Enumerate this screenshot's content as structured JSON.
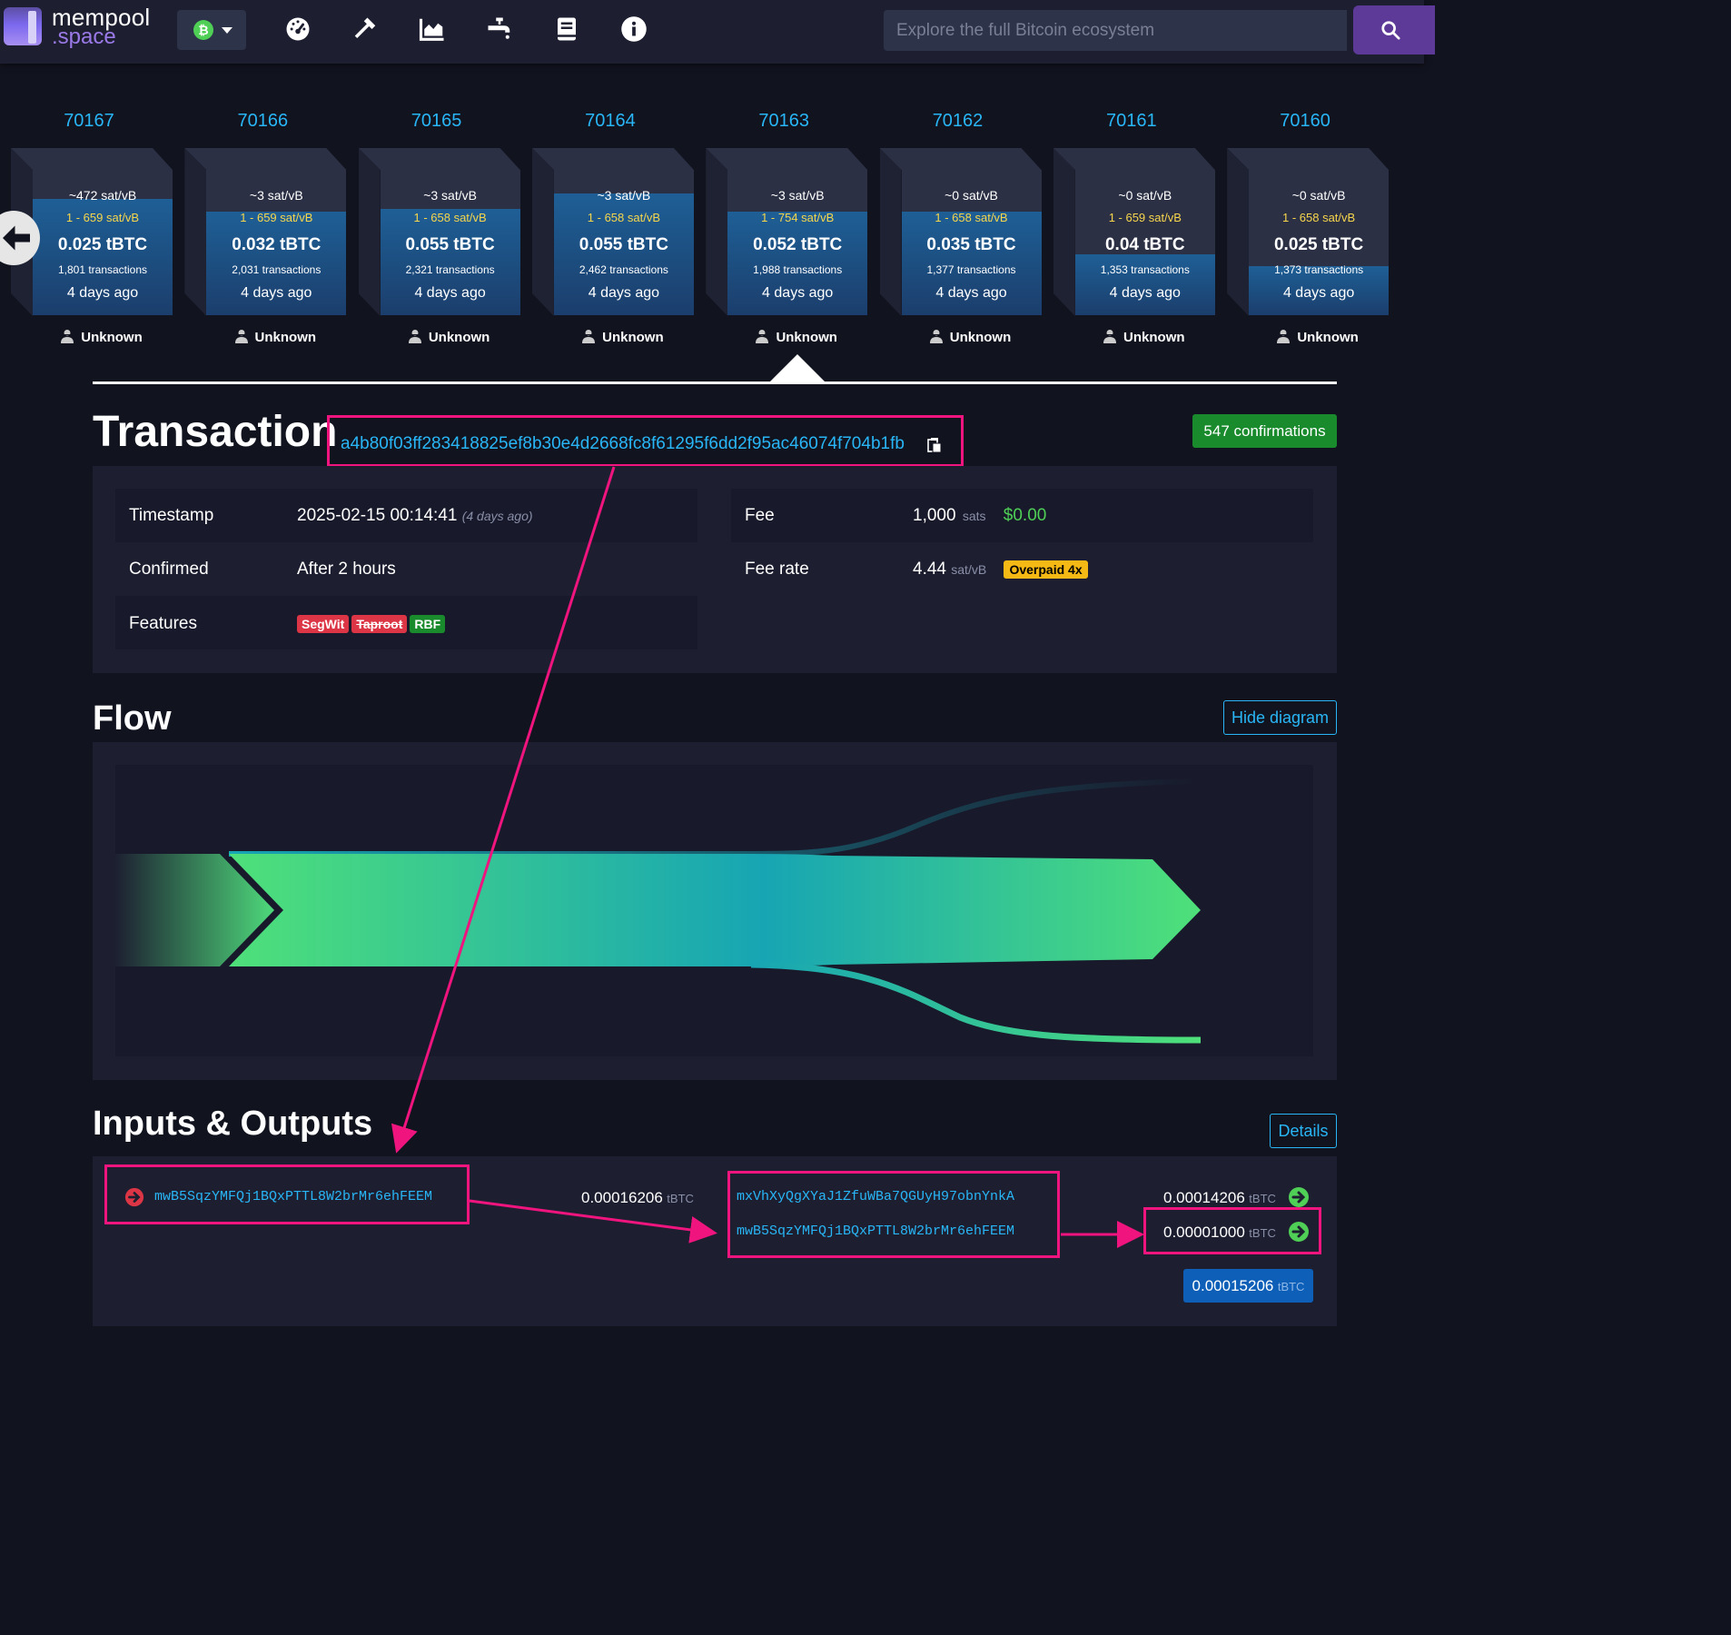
{
  "header": {
    "logo_line1": "mempool",
    "logo_line2": ".space",
    "search_placeholder": "Explore the full Bitcoin ecosystem",
    "nav_icons": [
      "dashboard-icon",
      "mining-icon",
      "graphs-icon",
      "faucet-icon",
      "docs-icon",
      "about-icon"
    ]
  },
  "blocks": [
    {
      "height": "70167",
      "median": "~472 sat/vB",
      "range": "1 - 659 sat/vB",
      "size": "0.025 tBTC",
      "txs": "1,801 transactions",
      "time": "4 days ago",
      "pool": "Unknown",
      "fill": 0.8
    },
    {
      "height": "70166",
      "median": "~3 sat/vB",
      "range": "1 - 659 sat/vB",
      "size": "0.032 tBTC",
      "txs": "2,031 transactions",
      "time": "4 days ago",
      "pool": "Unknown",
      "fill": 0.71
    },
    {
      "height": "70165",
      "median": "~3 sat/vB",
      "range": "1 - 658 sat/vB",
      "size": "0.055 tBTC",
      "txs": "2,321 transactions",
      "time": "4 days ago",
      "pool": "Unknown",
      "fill": 0.73
    },
    {
      "height": "70164",
      "median": "~3 sat/vB",
      "range": "1 - 658 sat/vB",
      "size": "0.055 tBTC",
      "txs": "2,462 transactions",
      "time": "4 days ago",
      "pool": "Unknown",
      "fill": 0.84
    },
    {
      "height": "70163",
      "median": "~3 sat/vB",
      "range": "1 - 754 sat/vB",
      "size": "0.052 tBTC",
      "txs": "1,988 transactions",
      "time": "4 days ago",
      "pool": "Unknown",
      "fill": 0.71
    },
    {
      "height": "70162",
      "median": "~0 sat/vB",
      "range": "1 - 658 sat/vB",
      "size": "0.035 tBTC",
      "txs": "1,377 transactions",
      "time": "4 days ago",
      "pool": "Unknown",
      "fill": 0.71
    },
    {
      "height": "70161",
      "median": "~0 sat/vB",
      "range": "1 - 659 sat/vB",
      "size": "0.04 tBTC",
      "txs": "1,353 transactions",
      "time": "4 days ago",
      "pool": "Unknown",
      "fill": 0.42
    },
    {
      "height": "70160",
      "median": "~0 sat/vB",
      "range": "1 - 658 sat/vB",
      "size": "0.025 tBTC",
      "txs": "1,373 transactions",
      "time": "4 days ago",
      "pool": "Unknown",
      "fill": 0.34
    }
  ],
  "transaction": {
    "title": "Transaction",
    "txid": "a4b80f03ff283418825ef8b30e4d2668fc8f61295f6dd2f95ac46074f704b1fb",
    "confirmations": "547 confirmations",
    "timestamp_label": "Timestamp",
    "timestamp_value": "2025-02-15 00:14:41",
    "timestamp_ago": "(4 days ago)",
    "confirmed_label": "Confirmed",
    "confirmed_value": "After 2 hours",
    "features_label": "Features",
    "features": [
      "SegWit",
      "Taproot",
      "RBF"
    ],
    "fee_label": "Fee",
    "fee_value": "1,000",
    "fee_unit": "sats",
    "fee_usd": "$0.00",
    "feerate_label": "Fee rate",
    "feerate_value": "4.44",
    "feerate_unit": "sat/vB",
    "overpaid": "Overpaid 4x"
  },
  "flow": {
    "title": "Flow",
    "toggle_label": "Hide diagram"
  },
  "io": {
    "title": "Inputs & Outputs",
    "details_label": "Details",
    "inputs": [
      {
        "address": "mwB5SqzYMFQj1BQxPTTL8W2brMr6ehFEEM",
        "amount": "0.00016206",
        "unit": "tBTC"
      }
    ],
    "outputs": [
      {
        "address": "mxVhXyQgXYaJ1ZfuWBa7QGUyH97obnYnkA",
        "amount": "0.00014206",
        "unit": "tBTC"
      },
      {
        "address": "mwB5SqzYMFQj1BQxPTTL8W2brMr6ehFEEM",
        "amount": "0.00001000",
        "unit": "tBTC"
      }
    ],
    "total_amount": "0.00015206",
    "total_unit": "tBTC"
  },
  "colors": {
    "accent": "#29b6f6",
    "highlight": "#f0147e",
    "confirm_green": "#198b2c",
    "fee_yellow": "#f5b915"
  }
}
